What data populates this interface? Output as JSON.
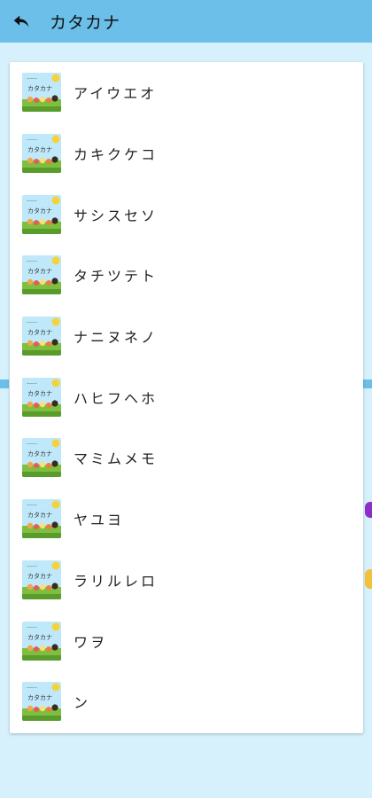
{
  "header": {
    "title": "カタカナ"
  },
  "thumbnail": {
    "caption": "カタカナ",
    "icon": "katakana-thumbnail-icon"
  },
  "list": {
    "items": [
      {
        "label": "アイウエオ"
      },
      {
        "label": "カキクケコ"
      },
      {
        "label": "サシスセソ"
      },
      {
        "label": "タチツテト"
      },
      {
        "label": "ナニヌネノ"
      },
      {
        "label": "ハヒフヘホ"
      },
      {
        "label": "マミムメモ"
      },
      {
        "label": "ヤユヨ"
      },
      {
        "label": "ラリルレロ"
      },
      {
        "label": "ワヲ"
      },
      {
        "label": "ン"
      }
    ]
  },
  "colors": {
    "header_bg": "#6bbfe9",
    "page_bg": "#d6f1fb",
    "card_bg": "#ffffff"
  }
}
